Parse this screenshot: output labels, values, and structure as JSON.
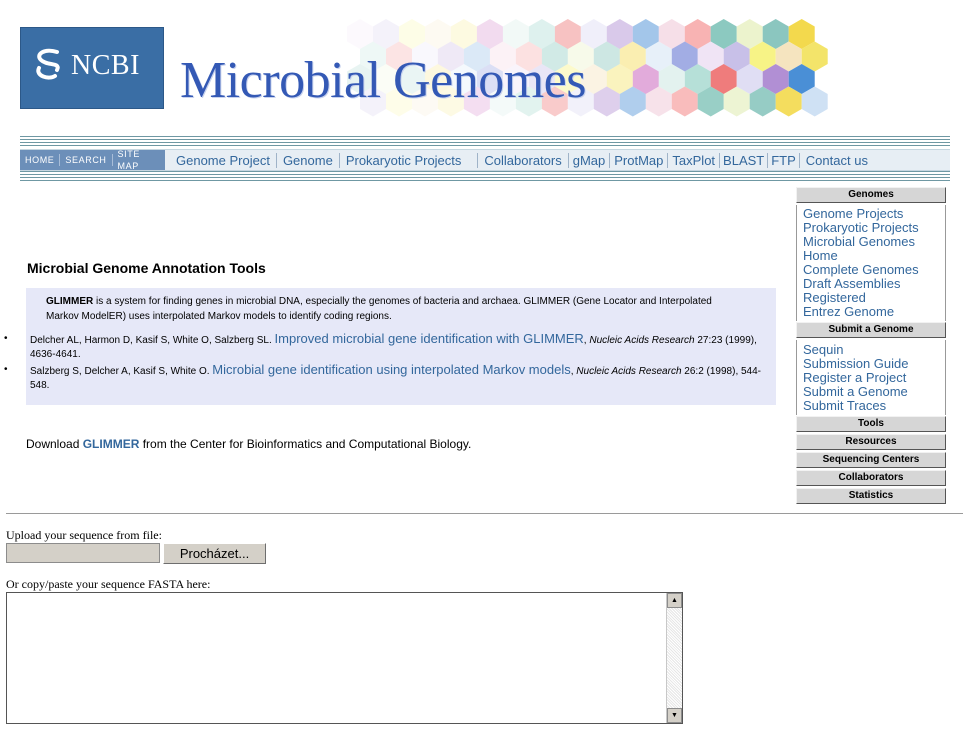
{
  "header": {
    "logo_text": "NCBI",
    "title": "Microbial Genomes"
  },
  "nav": {
    "mini": [
      "HOME",
      "SEARCH",
      "SITE MAP"
    ],
    "links": [
      "Genome Project",
      "Genome",
      "Prokaryotic Projects",
      "Collaborators",
      "gMap",
      "ProtMap",
      "TaxPlot",
      "BLAST",
      "FTP",
      "Contact us"
    ]
  },
  "main": {
    "heading": "Microbial Genome Annotation Tools",
    "intro_bold": "GLIMMER",
    "intro_rest": " is a system for finding genes in microbial DNA, especially the genomes of bacteria and archaea. GLIMMER (Gene Locator and Interpolated Markov ModelER) uses interpolated Markov models to identify coding regions.",
    "refs": [
      {
        "authors": "Delcher AL, Harmon D, Kasif S, White O, Salzberg SL. ",
        "link": "Improved microbial gene identification with GLIMMER",
        "journal": "Nucleic Acids Research",
        "tail": " 27:23 (1999), 4636-4641."
      },
      {
        "authors": "Salzberg S, Delcher A, Kasif S, White O. ",
        "link": "Microbial gene identification using interpolated Markov models",
        "journal": "Nucleic Acids Research",
        "tail": " 26:2 (1998), 544-548."
      }
    ],
    "download_prefix": "Download ",
    "download_link": "GLIMMER",
    "download_suffix": " from the Center for Bioinformatics and Computational Biology."
  },
  "sidebar": {
    "genomes_header": "Genomes",
    "genomes_links": [
      "Genome Projects",
      "Prokaryotic Projects",
      "Microbial Genomes Home",
      "Complete Genomes",
      "Draft Assemblies",
      "Registered",
      "Entrez Genome"
    ],
    "submit_header": "Submit a Genome",
    "submit_links": [
      "Sequin",
      "Submission Guide",
      "Register a Project",
      "Submit a Genome",
      "Submit Traces"
    ],
    "collapsed": [
      "Tools",
      "Resources",
      "Sequencing Centers",
      "Collaborators",
      "Statistics"
    ]
  },
  "form": {
    "upload_label": "Upload your sequence from file:",
    "browse_label": "Procházet...",
    "paste_label": "Or copy/paste your sequence FASTA here:",
    "file_value": "",
    "sequence_value": ""
  },
  "colors": {
    "link": "#33679c",
    "logo_bg": "#3a6ea5",
    "title": "#3459b5",
    "infobox": "#e6e8f8"
  }
}
